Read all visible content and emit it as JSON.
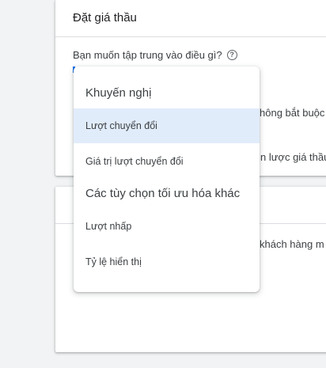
{
  "bidding_card": {
    "title": "Đặt giá thầu",
    "question": "Bạn muốn tập trung vào điều gì?",
    "optional_fragment": "hông bắt buộc",
    "strategy_fragment": "n lược giá thầu"
  },
  "second_card": {
    "customers_fragment": "khách hàng m"
  },
  "dropdown_menu": {
    "recommended_header": "Khuyến nghị",
    "recommended_items": [
      {
        "label": "Lượt chuyển đổi",
        "selected": true
      },
      {
        "label": "Giá trị lượt chuyển đổi",
        "selected": false
      }
    ],
    "other_header": "Các tùy chọn tối ưu hóa khác",
    "other_items": [
      {
        "label": "Lượt nhấp",
        "selected": false
      },
      {
        "label": "Tỷ lệ hiển thị",
        "selected": false
      }
    ]
  },
  "icons": {
    "help": "help-circle-icon"
  },
  "colors": {
    "selected_bg": "#e1ecfb",
    "accent": "#1a73e8",
    "page_bg": "#f1f3f4"
  }
}
